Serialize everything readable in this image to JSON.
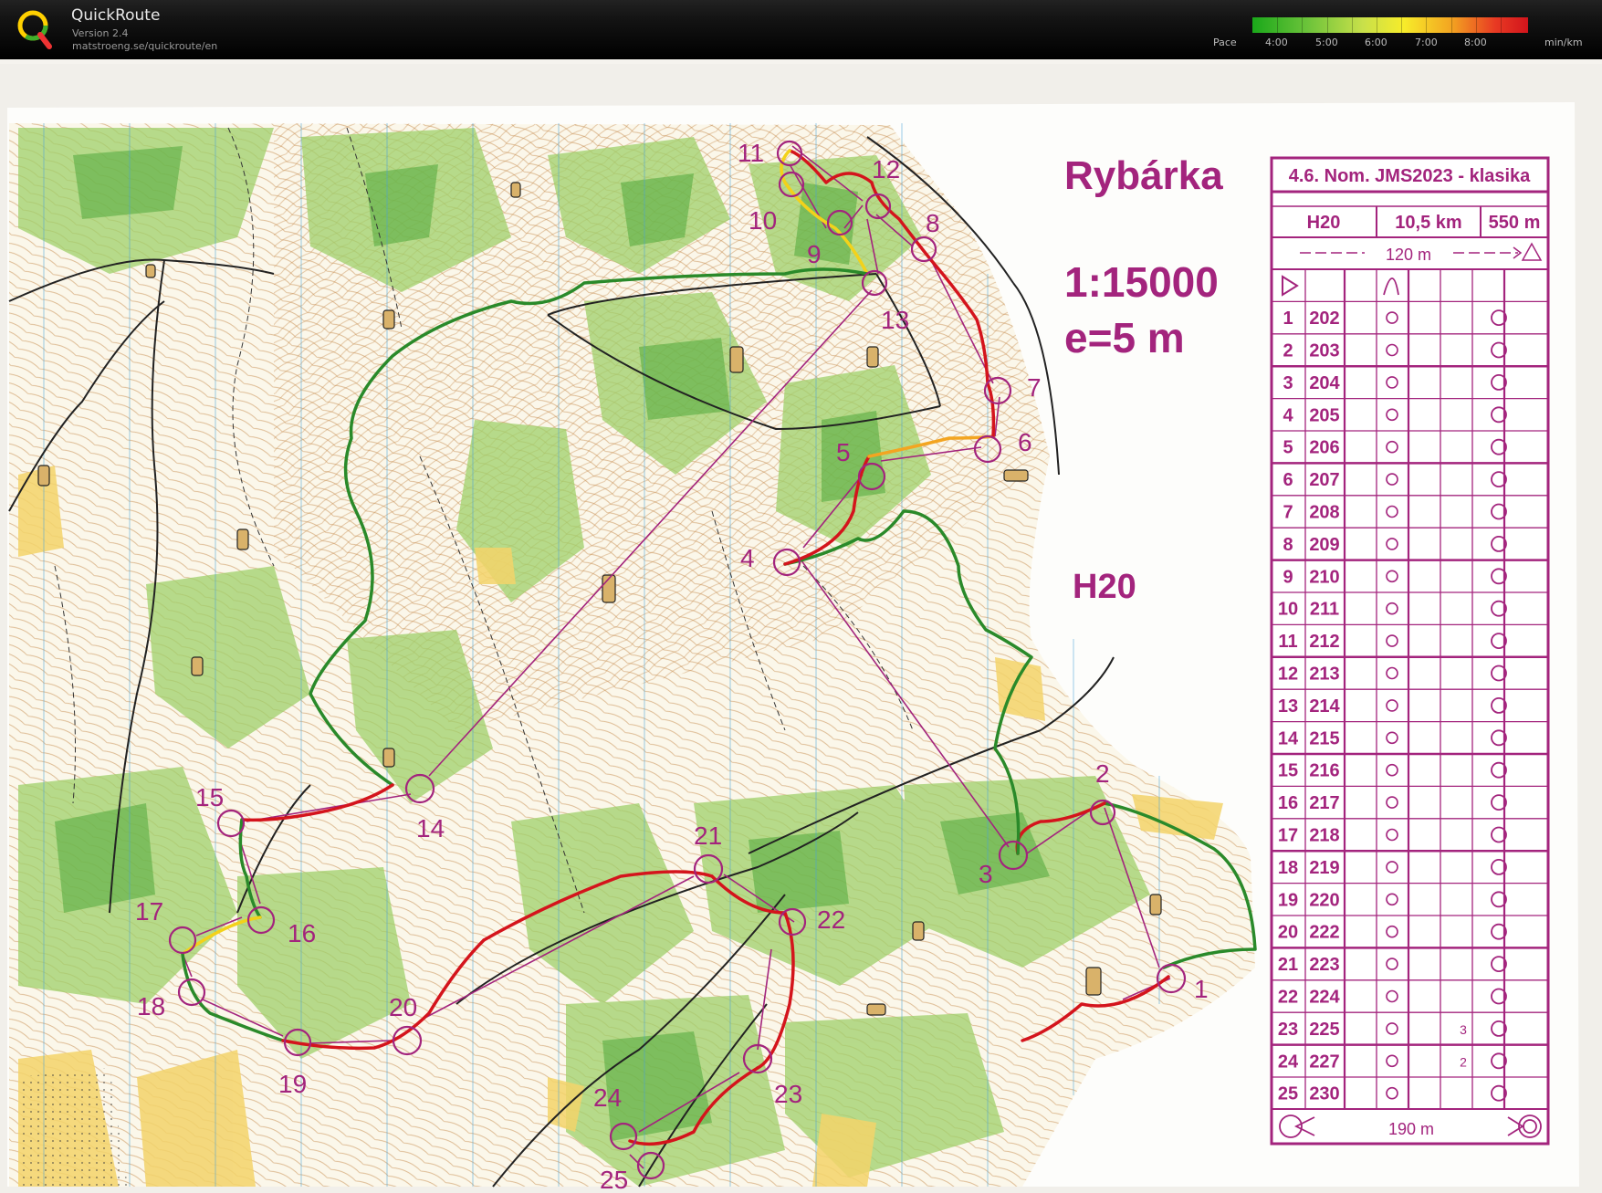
{
  "app": {
    "name": "QuickRoute",
    "version": "Version 2.4",
    "url": "matstroeng.se/quickroute/en"
  },
  "pace_legend": {
    "label": "Pace",
    "ticks": [
      "4:00",
      "5:00",
      "6:00",
      "7:00",
      "8:00"
    ],
    "unit": "min/km"
  },
  "map": {
    "area_name": "Rybárka",
    "scale": "1:15000",
    "contour": "e=5 m",
    "category": "H20",
    "control_labels": [
      "1",
      "2",
      "3",
      "4",
      "5",
      "6",
      "7",
      "8",
      "9",
      "10",
      "11",
      "12",
      "13",
      "14",
      "15",
      "16",
      "17",
      "18",
      "19",
      "20",
      "21",
      "22",
      "23",
      "24",
      "25"
    ]
  },
  "description_sheet": {
    "title": "4.6. Nom. JMS2023 - klasika",
    "class": "H20",
    "length": "10,5 km",
    "climb": "550 m",
    "start_leg": "120 m",
    "finish_leg": "190 m",
    "rows": [
      {
        "no": "1",
        "code": "202",
        "extra": ""
      },
      {
        "no": "2",
        "code": "203",
        "extra": ""
      },
      {
        "no": "3",
        "code": "204",
        "extra": ""
      },
      {
        "no": "4",
        "code": "205",
        "extra": ""
      },
      {
        "no": "5",
        "code": "206",
        "extra": ""
      },
      {
        "no": "6",
        "code": "207",
        "extra": ""
      },
      {
        "no": "7",
        "code": "208",
        "extra": ""
      },
      {
        "no": "8",
        "code": "209",
        "extra": ""
      },
      {
        "no": "9",
        "code": "210",
        "extra": ""
      },
      {
        "no": "10",
        "code": "211",
        "extra": ""
      },
      {
        "no": "11",
        "code": "212",
        "extra": ""
      },
      {
        "no": "12",
        "code": "213",
        "extra": ""
      },
      {
        "no": "13",
        "code": "214",
        "extra": ""
      },
      {
        "no": "14",
        "code": "215",
        "extra": ""
      },
      {
        "no": "15",
        "code": "216",
        "extra": ""
      },
      {
        "no": "16",
        "code": "217",
        "extra": ""
      },
      {
        "no": "17",
        "code": "218",
        "extra": ""
      },
      {
        "no": "18",
        "code": "219",
        "extra": ""
      },
      {
        "no": "19",
        "code": "220",
        "extra": ""
      },
      {
        "no": "20",
        "code": "222",
        "extra": ""
      },
      {
        "no": "21",
        "code": "223",
        "extra": ""
      },
      {
        "no": "22",
        "code": "224",
        "extra": ""
      },
      {
        "no": "23",
        "code": "225",
        "extra": "3"
      },
      {
        "no": "24",
        "code": "227",
        "extra": "2"
      },
      {
        "no": "25",
        "code": "230",
        "extra": ""
      }
    ]
  },
  "colors": {
    "purple": "#a3247d",
    "route_green": "#2a8a2a",
    "route_red": "#d4141c",
    "map_green": "#9fd06a",
    "map_yellow": "#f3d36a",
    "contour": "#c58a4c"
  }
}
